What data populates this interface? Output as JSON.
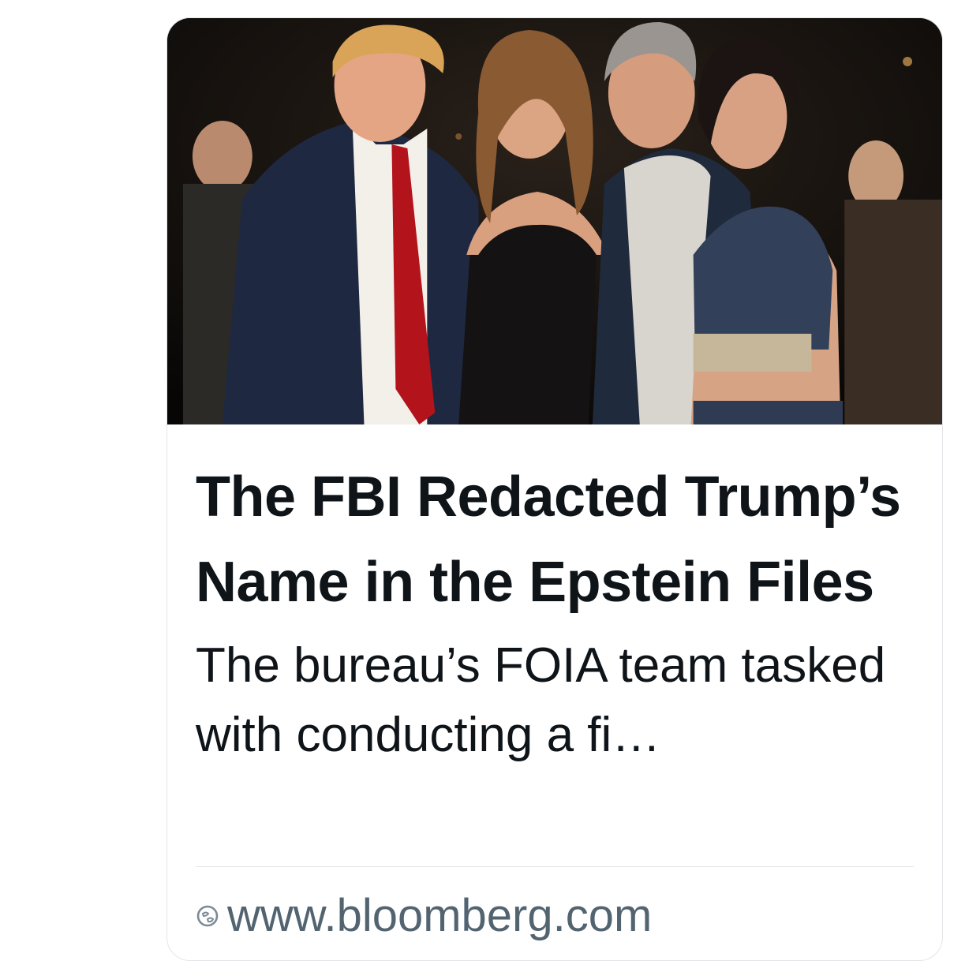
{
  "link_card": {
    "headline": "The FBI Redacted Trump’s Name in the Epstein Files",
    "description": "The bureau’s FOIA team tasked with conducting a fi…",
    "source_icon": "link-globe-icon",
    "domain": "www.bloomberg.com"
  },
  "colors": {
    "headline": "#0f1419",
    "domain": "#536471",
    "border": "#e3e5e8"
  }
}
